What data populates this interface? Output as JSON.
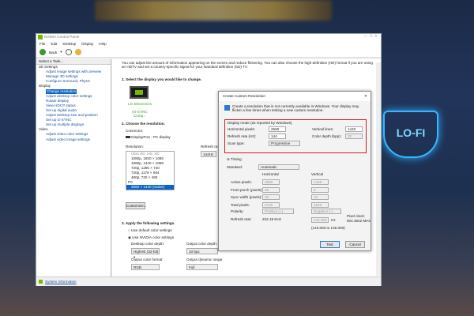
{
  "window": {
    "title": "NVIDIA Control Panel",
    "menu": [
      "File",
      "Edit",
      "Desktop",
      "Display",
      "Help"
    ],
    "back": "Back"
  },
  "sidebar": {
    "header": "Select a Task...",
    "groups": [
      {
        "label": "3D Settings",
        "items": [
          "Adjust image settings with preview",
          "Manage 3D settings",
          "Configure Surround, PhysX"
        ]
      },
      {
        "label": "Display",
        "items": [
          "Change resolution",
          "Adjust desktop color settings",
          "Rotate display",
          "View HDCP status",
          "Set up digital audio",
          "Adjust desktop size and position",
          "Set up G-SYNC",
          "Set up multiple displays"
        ]
      },
      {
        "label": "Video",
        "items": [
          "Adjust video color settings",
          "Adjust video image settings"
        ]
      }
    ],
    "selected": "Change resolution",
    "system_info": "System Information"
  },
  "main": {
    "intro": "You can adjust the amount of information appearing on the screen and reduce flickering. You can also choose the high-definition (HD) format if you are using an HDTV and set a country-specific signal for your standard definition (SD) TV.",
    "step1": "1. Select the display you would like to change.",
    "display_name": "LG Electronics ...",
    "display_sub": "(G-SYNC Comp...",
    "step2": "2. Choose the resolution.",
    "connector_label": "Connector:",
    "connector": "DisplayPort - PC display",
    "resolution_label": "Resolution:",
    "refresh_label": "Refresh rate:",
    "refresh_value": "144Hz",
    "resolutions": [
      "Ultra HD, HD, SD",
      "1080p, 1920 × 1080",
      "1080p, 1440 × 1080",
      "720p, 1280 × 720",
      "720p, 1176 × 664",
      "480p, 720 × 480"
    ],
    "pc_group": "PC",
    "selected_resolution": "2560 × 1440 (native)",
    "customize": "Customize...",
    "step3": "3. Apply the following settings.",
    "radio_default": "Use default color settings",
    "radio_nvidia": "Use NVIDIA color settings",
    "desktop_depth_label": "Desktop color depth:",
    "desktop_depth": "Highest (32-bit)",
    "output_depth_label": "Output color depth:",
    "output_depth": "10 bpc",
    "output_format_label": "Output color format:",
    "output_format": "RGB",
    "output_range_label": "Output dynamic range:",
    "output_range": "Full"
  },
  "dialog": {
    "title": "Create Custom Resolution",
    "info": "Create a resolution that is not currently available in Windows. Your display may flicker a few times when testing a new custom resolution.",
    "mode_label": "Display mode (as reported by Windows)",
    "h_pixels_label": "Horizontal pixels:",
    "h_pixels": "2560",
    "v_lines_label": "Vertical lines:",
    "v_lines": "1440",
    "refresh_label": "Refresh rate (Hz):",
    "refresh": "144",
    "depth_label": "Color depth (bpp):",
    "depth": "32",
    "scan_label": "Scan type:",
    "scan": "Progressive",
    "timing": "Timing",
    "standard_label": "Standard:",
    "standard": "Automatic",
    "col_h": "Horizontal",
    "col_v": "Vertical",
    "rows": [
      {
        "label": "Active pixels:",
        "h": "2560",
        "v": "1440"
      },
      {
        "label": "Front porch (pixels):",
        "h": "48",
        "v": "3"
      },
      {
        "label": "Sync width (pixels):",
        "h": "32",
        "v": "10"
      },
      {
        "label": "Total pixels:",
        "h": "2720",
        "v": "1543"
      }
    ],
    "polarity_label": "Polarity:",
    "polarity_h": "Positive (+)",
    "polarity_v": "Negative (-)",
    "refresh_rate_label": "Refresh rate:",
    "h_rate": "222.19 KHz",
    "v_rate": "144.000",
    "hz": "Hz",
    "range": "(143.000 to 145.000)",
    "pixel_clock_label": "Pixel clock:",
    "pixel_clock": "604.3622 MHz",
    "test": "Test",
    "cancel": "Cancel"
  },
  "colors": {
    "accent": "#0a64c8",
    "highlight_box": "#c8202a",
    "nvidia_green": "#76b900"
  }
}
